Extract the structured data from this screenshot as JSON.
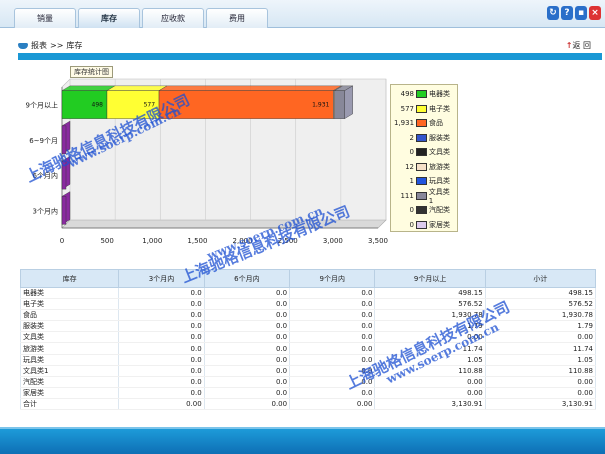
{
  "tabs": [
    {
      "label": "销量",
      "active": false
    },
    {
      "label": "库存",
      "active": true
    },
    {
      "label": "应收款",
      "active": false
    },
    {
      "label": "费用",
      "active": false
    }
  ],
  "breadcrumb": {
    "root": "报表",
    "sep": ">>",
    "current": "库存"
  },
  "back_label": "返 回",
  "chart_title": "库存统计图",
  "chart_data": {
    "type": "bar",
    "orientation": "horizontal-stacked",
    "categories": [
      "9个月以上",
      "6~9个月",
      "6个月内",
      "3个月内"
    ],
    "x_ticks": [
      "0",
      "500",
      "1,000",
      "1,500",
      "2,000",
      "2,500",
      "3,000",
      "3,500"
    ],
    "xlim": [
      0,
      3500
    ],
    "series": [
      {
        "name": "电器类",
        "color": "#22cc22",
        "values": [
          498.15,
          0,
          0,
          0
        ]
      },
      {
        "name": "电子类",
        "color": "#ffff33",
        "values": [
          576.52,
          0,
          0,
          0
        ]
      },
      {
        "name": "食品",
        "color": "#ff6622",
        "values": [
          1930.78,
          0,
          0,
          0
        ]
      },
      {
        "name": "服装类",
        "color": "#3355cc",
        "values": [
          1.79,
          0,
          0,
          0
        ]
      },
      {
        "name": "文具类",
        "color": "#222222",
        "values": [
          0,
          0,
          0,
          0
        ]
      },
      {
        "name": "旅游类",
        "color": "#f5e0c8",
        "values": [
          11.74,
          0,
          0,
          0
        ]
      },
      {
        "name": "玩具类",
        "color": "#2255dd",
        "values": [
          1.05,
          0,
          0,
          0
        ]
      },
      {
        "name": "文具类1",
        "color": "#888899",
        "values": [
          110.88,
          0,
          0,
          0
        ]
      },
      {
        "name": "汽配类",
        "color": "#333333",
        "values": [
          0,
          0,
          0,
          0
        ]
      },
      {
        "name": "家居类",
        "color": "#ddccee",
        "values": [
          0,
          0,
          0,
          0
        ]
      }
    ],
    "data_labels": [
      {
        "series": 0,
        "text": "498"
      },
      {
        "series": 1,
        "text": "577"
      },
      {
        "series": 2,
        "text": "1,931"
      }
    ]
  },
  "legend": [
    {
      "value": "498",
      "label": "电器类",
      "color": "#22cc22"
    },
    {
      "value": "577",
      "label": "电子类",
      "color": "#ffff33"
    },
    {
      "value": "1,931",
      "label": "食品",
      "color": "#ff6622"
    },
    {
      "value": "2",
      "label": "服装类",
      "color": "#3355cc"
    },
    {
      "value": "0",
      "label": "文具类",
      "color": "#222222"
    },
    {
      "value": "12",
      "label": "旅游类",
      "color": "#f5e0c8"
    },
    {
      "value": "1",
      "label": "玩具类",
      "color": "#2255dd"
    },
    {
      "value": "111",
      "label": "文具类1",
      "color": "#888899"
    },
    {
      "value": "0",
      "label": "汽配类",
      "color": "#333333"
    },
    {
      "value": "0",
      "label": "家居类",
      "color": "#ddccee"
    }
  ],
  "table": {
    "headers": [
      "库存",
      "3个月内",
      "6个月内",
      "9个月内",
      "9个月以上",
      "小计"
    ],
    "rows": [
      [
        "电器类",
        "0.0",
        "0.0",
        "0.0",
        "498.15",
        "498.15"
      ],
      [
        "电子类",
        "0.0",
        "0.0",
        "0.0",
        "576.52",
        "576.52"
      ],
      [
        "食品",
        "0.0",
        "0.0",
        "0.0",
        "1,930.78",
        "1,930.78"
      ],
      [
        "服装类",
        "0.0",
        "0.0",
        "0.0",
        "1.79",
        "1.79"
      ],
      [
        "文具类",
        "0.0",
        "0.0",
        "0.0",
        "0.00",
        "0.00"
      ],
      [
        "旅游类",
        "0.0",
        "0.0",
        "0.0",
        "11.74",
        "11.74"
      ],
      [
        "玩具类",
        "0.0",
        "0.0",
        "0.0",
        "1.05",
        "1.05"
      ],
      [
        "文具类1",
        "0.0",
        "0.0",
        "0.0",
        "110.88",
        "110.88"
      ],
      [
        "汽配类",
        "0.0",
        "0.0",
        "0.0",
        "0.00",
        "0.00"
      ],
      [
        "家居类",
        "0.0",
        "0.0",
        "0.0",
        "0.00",
        "0.00"
      ]
    ],
    "total": [
      "合计",
      "0.00",
      "0.00",
      "0.00",
      "3,130.91",
      "3,130.91"
    ]
  },
  "watermark": {
    "company": "上海驰格信息科技有限公司",
    "url": "www.soerp.com.cn"
  }
}
